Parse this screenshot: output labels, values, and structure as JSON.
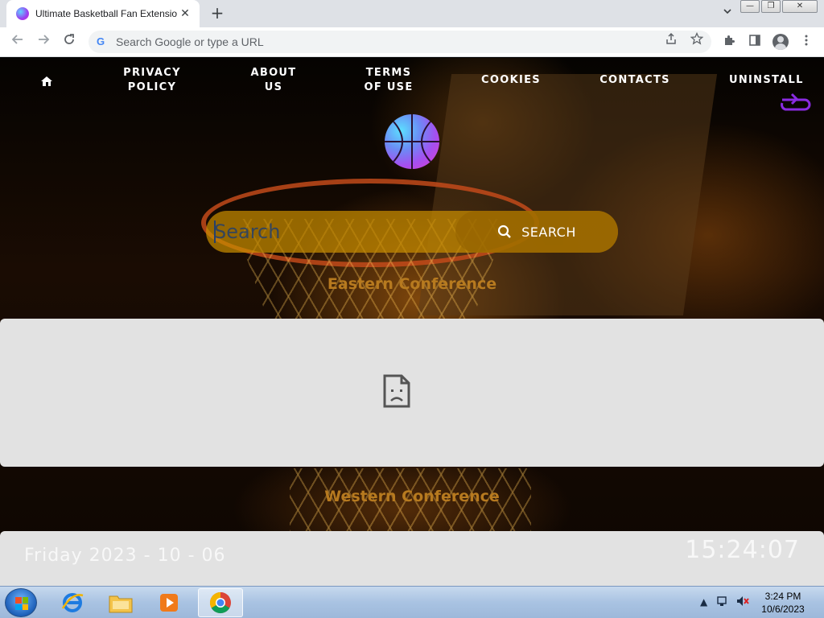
{
  "browser": {
    "tab_title": "Ultimate Basketball Fan Extension",
    "tab_close": "✕",
    "new_tab": "+",
    "omnibox_placeholder": "Search Google or type a URL",
    "window_buttons": {
      "minimize": "—",
      "maximize": "❐",
      "close": "✕"
    }
  },
  "nav": {
    "links": [
      {
        "label": "PRIVACY\nPOLICY"
      },
      {
        "label": "ABOUT\nUS"
      },
      {
        "label": "TERMS\nOF USE"
      },
      {
        "label": "COOKIES"
      },
      {
        "label": "CONTACTS"
      },
      {
        "label": "UNINSTALL"
      }
    ]
  },
  "search": {
    "placeholder": "Search",
    "button_label": "SEARCH"
  },
  "sections": {
    "eastern": "Eastern Conference",
    "western": "Western Conference"
  },
  "footer": {
    "date": "Friday 2023 - 10 - 06",
    "time": "15:24:07"
  },
  "taskbar": {
    "clock_time": "3:24 PM",
    "clock_date": "10/6/2023"
  },
  "colors": {
    "search_bg": "#c88c00",
    "conference_text": "#b77a1f",
    "panel_bg": "#e2e2e2",
    "share_icon": "#8a2be2"
  }
}
